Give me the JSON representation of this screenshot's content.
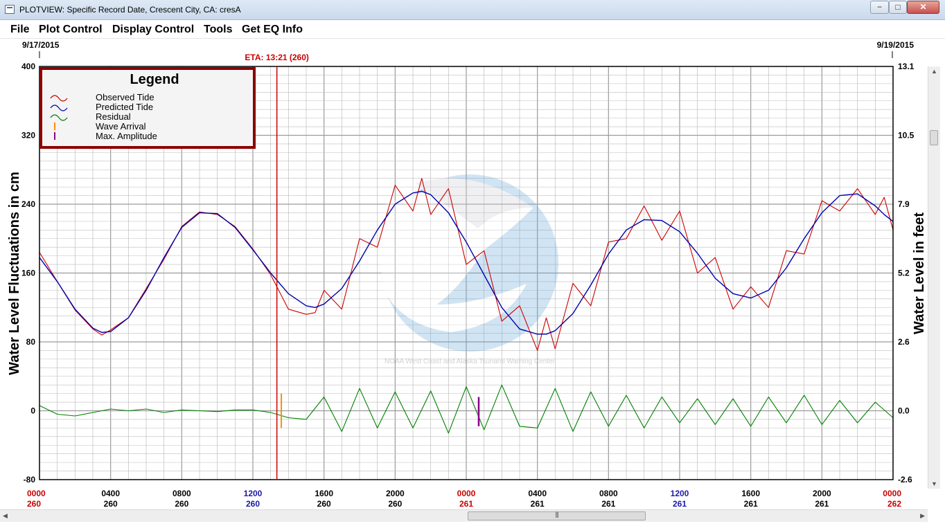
{
  "window": {
    "title": "PLOTVIEW: Specific Record Date, Crescent City, CA: cresA",
    "minimize_label": "−",
    "maximize_label": "□",
    "close_label": "✕"
  },
  "menu": {
    "items": [
      "File",
      "Plot Control",
      "Display Control",
      "Tools",
      "Get EQ Info"
    ]
  },
  "colors": {
    "observed": "#cc0000",
    "predicted": "#0000aa",
    "residual": "#008000",
    "wave_arrival": "#ff8c00",
    "max_amplitude": "#8b008b",
    "eta": "#cc0000",
    "legend_border": "#8b0000",
    "grid": "#bdbdbd",
    "day_blue": "#1a1aa6"
  },
  "chart_data": {
    "type": "line",
    "date_start": "9/17/2015",
    "date_end": "9/19/2015",
    "eta_label": "ETA: 13:21 (260)",
    "eta_hour": 13.35,
    "ylabel_left": "Water Level Fluctuations in cm",
    "ylabel_right": "Water Level in feet",
    "ylim_left": [
      -80,
      400
    ],
    "ylim_right": [
      -2.6,
      13.1
    ],
    "xlim_hours": [
      0,
      48
    ],
    "y_ticks_left": [
      "400",
      "320",
      "240",
      "160",
      "80",
      "0",
      "-80"
    ],
    "y_ticks_right": [
      "13.1",
      "10.5",
      "7.9",
      "5.2",
      "2.6",
      "0.0",
      "-2.6"
    ],
    "x_ticks_time": [
      "0000",
      "0400",
      "0800",
      "1200",
      "1600",
      "2000",
      "0000",
      "0400",
      "0800",
      "1200",
      "1600",
      "2000",
      "0000"
    ],
    "x_ticks_day": [
      "260",
      "260",
      "260",
      "260",
      "260",
      "260",
      "261",
      "261",
      "261",
      "261",
      "261",
      "261",
      "262"
    ],
    "x_tick_colors": [
      "red",
      "black",
      "black",
      "blue",
      "black",
      "black",
      "red",
      "black",
      "black",
      "blue",
      "black",
      "black",
      "red"
    ],
    "wave_arrival_hour": 13.6,
    "max_amplitude_hour": 24.7,
    "legend": {
      "title": "Legend",
      "entries": [
        "Observed Tide",
        "Predicted Tide",
        "Residual",
        "Wave Arrival",
        "Max. Amplitude"
      ]
    },
    "watermark_text": "NOAA West Coast and Alaska Tsunami Warning Center",
    "series": [
      {
        "name": "Predicted Tide",
        "unit": "cm",
        "x": [
          0,
          1,
          2,
          3,
          3.5,
          4,
          5,
          6,
          7,
          8,
          9,
          10,
          11,
          12,
          13,
          14,
          15,
          15.5,
          16,
          17,
          18,
          19,
          20,
          21,
          21.5,
          22,
          23,
          24,
          25,
          26,
          27,
          28,
          28.5,
          29,
          30,
          31,
          32,
          33,
          34,
          35,
          36,
          37,
          38,
          39,
          40,
          41,
          42,
          43,
          44,
          45,
          46,
          47,
          47.5,
          48
        ],
        "values": [
          178,
          150,
          118,
          96,
          91,
          92,
          108,
          140,
          178,
          213,
          230,
          229,
          213,
          187,
          160,
          136,
          122,
          120,
          124,
          142,
          174,
          210,
          240,
          253,
          255,
          251,
          230,
          196,
          158,
          120,
          95,
          89,
          89,
          93,
          113,
          146,
          182,
          210,
          222,
          221,
          208,
          183,
          154,
          136,
          131,
          140,
          166,
          200,
          230,
          250,
          252,
          238,
          228,
          220
        ]
      },
      {
        "name": "Observed Tide",
        "unit": "cm",
        "x": [
          0,
          1,
          2,
          3,
          3.5,
          4,
          5,
          6,
          7,
          8,
          9,
          10,
          11,
          12,
          13,
          14,
          15,
          15.5,
          16,
          17,
          18,
          19,
          20,
          21,
          21.5,
          22,
          23,
          24,
          25,
          26,
          27,
          28,
          28.5,
          29,
          30,
          31,
          32,
          33,
          34,
          35,
          36,
          37,
          38,
          39,
          40,
          41,
          42,
          43,
          44,
          45,
          46,
          47,
          47.5,
          48
        ],
        "values": [
          184,
          150,
          117,
          95,
          88,
          94,
          108,
          142,
          176,
          214,
          231,
          228,
          214,
          188,
          158,
          118,
          112,
          114,
          140,
          118,
          200,
          190,
          262,
          232,
          270,
          228,
          258,
          170,
          186,
          104,
          122,
          70,
          108,
          72,
          148,
          122,
          196,
          200,
          238,
          198,
          232,
          160,
          178,
          118,
          144,
          120,
          186,
          182,
          244,
          232,
          258,
          228,
          248,
          210
        ]
      },
      {
        "name": "Residual",
        "unit": "cm",
        "x": [
          0,
          1,
          2,
          3,
          4,
          5,
          6,
          7,
          8,
          9,
          10,
          11,
          12,
          13,
          14,
          15,
          16,
          17,
          18,
          19,
          20,
          21,
          22,
          23,
          24,
          25,
          26,
          27,
          28,
          29,
          30,
          31,
          32,
          33,
          34,
          35,
          36,
          37,
          38,
          39,
          40,
          41,
          42,
          43,
          44,
          45,
          46,
          47,
          48
        ],
        "values": [
          6,
          -4,
          -6,
          -2,
          2,
          0,
          2,
          -2,
          1,
          0,
          -1,
          1,
          1,
          -2,
          -8,
          -10,
          16,
          -24,
          26,
          -20,
          22,
          -20,
          23,
          -26,
          28,
          -22,
          30,
          -18,
          -20,
          26,
          -24,
          22,
          -18,
          18,
          -20,
          16,
          -14,
          14,
          -16,
          14,
          -18,
          16,
          -14,
          18,
          -16,
          12,
          -14,
          10,
          -8
        ]
      }
    ]
  }
}
